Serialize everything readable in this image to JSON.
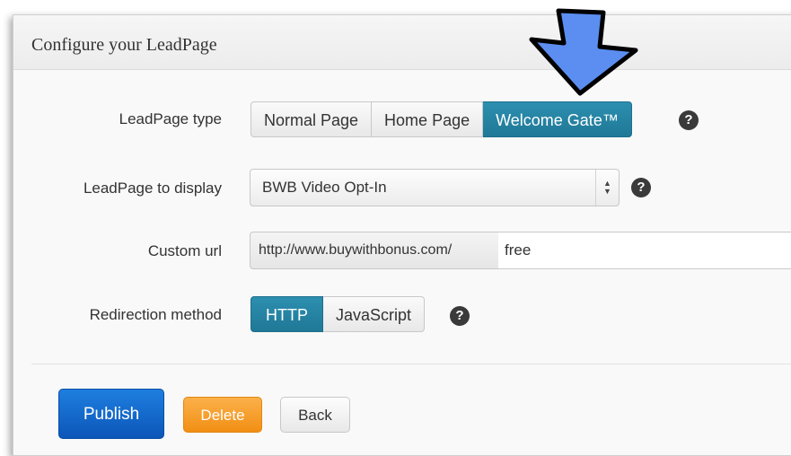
{
  "panel": {
    "title": "Configure your LeadPage"
  },
  "leadpage_type": {
    "label": "LeadPage type",
    "options": [
      "Normal Page",
      "Home Page",
      "Welcome Gate™"
    ],
    "selected": "Welcome Gate™"
  },
  "leadpage_display": {
    "label": "LeadPage to display",
    "value": "BWB Video Opt-In",
    "arrows": "▲▼"
  },
  "custom_url": {
    "label": "Custom url",
    "prefix": "http://www.buywithbonus.com/",
    "value": "free"
  },
  "redirection": {
    "label": "Redirection method",
    "options": [
      "HTTP",
      "JavaScript"
    ],
    "selected": "HTTP"
  },
  "help_symbol": "?",
  "actions": {
    "publish": "Publish",
    "delete": "Delete",
    "back": "Back"
  },
  "colors": {
    "active_segment": "#2288aa",
    "publish": "#1565c8",
    "delete": "#f5a030",
    "arrow": "#5b8ef0"
  },
  "icons": [
    "help-icon",
    "select-arrows-icon",
    "down-arrow-icon"
  ]
}
